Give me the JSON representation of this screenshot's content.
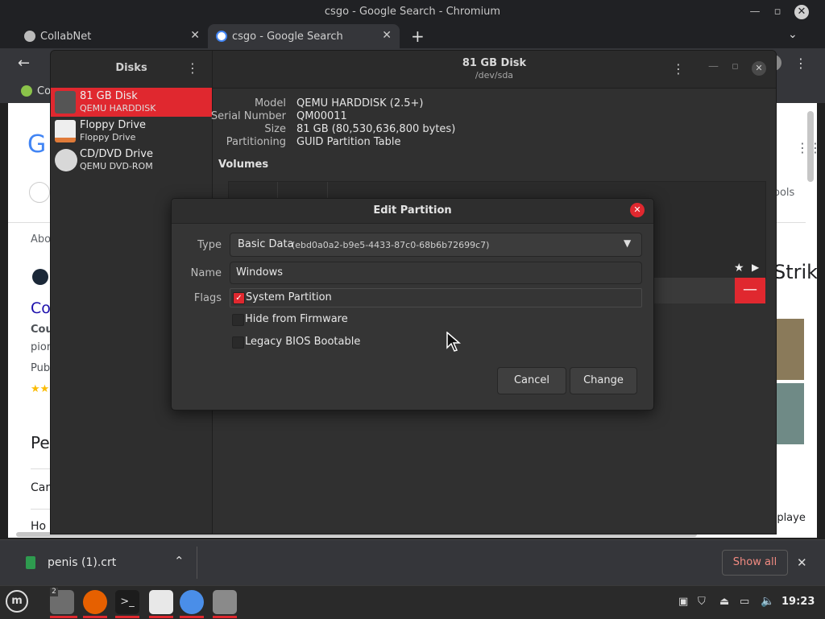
{
  "browser": {
    "window_title": "csgo - Google Search - Chromium",
    "tabs": [
      {
        "label": "CollabNet"
      },
      {
        "label": "csgo - Google Search"
      }
    ],
    "bookmark_fragment": "Co",
    "page_fragments": {
      "about": "Abo",
      "result_title": "Co",
      "result_bold": "Cou",
      "line_pio": "pion",
      "line_pub": "Pub",
      "stars": "★★",
      "heading_pe": "Pe",
      "line_car": "Car",
      "line_ho": "Ho",
      "tools": "ools",
      "strik": "Strik",
      "multiplayer": "ltiplaye"
    },
    "download": {
      "filename": "penis (1).crt",
      "show_all": "Show all"
    }
  },
  "disks": {
    "sidebar_title": "Disks",
    "header_title": "81 GB Disk",
    "header_subtitle": "/dev/sda",
    "drives": [
      {
        "name": "81 GB Disk",
        "sub": "QEMU HARDDISK"
      },
      {
        "name": "Floppy Drive",
        "sub": "Floppy Drive"
      },
      {
        "name": "CD/DVD Drive",
        "sub": "QEMU DVD-ROM"
      }
    ],
    "info": [
      {
        "key": "Model",
        "value": "QEMU HARDDISK (2.5+)"
      },
      {
        "key": "Serial Number",
        "value": "QM00011"
      },
      {
        "key": "Size",
        "value": "81 GB (80,530,636,800 bytes)"
      },
      {
        "key": "Partitioning",
        "value": "GUID Partition Table"
      }
    ],
    "volumes_label": "Volumes"
  },
  "dialog": {
    "title": "Edit Partition",
    "type_label": "Type",
    "type_value": "Basic Data",
    "type_guid": "(ebd0a0a2-b9e5-4433-87c0-68b6b72699c7)",
    "name_label": "Name",
    "name_value": "Windows",
    "flags_label": "Flags",
    "flags": [
      {
        "label": "System Partition",
        "checked": true
      },
      {
        "label": "Hide from Firmware",
        "checked": false
      },
      {
        "label": "Legacy BIOS Bootable",
        "checked": false
      }
    ],
    "cancel": "Cancel",
    "change": "Change"
  },
  "taskbar": {
    "clock": "19:23",
    "workspace_badge": "2"
  },
  "colors": {
    "accent": "#e0282f",
    "dialog_bg": "#353535"
  }
}
